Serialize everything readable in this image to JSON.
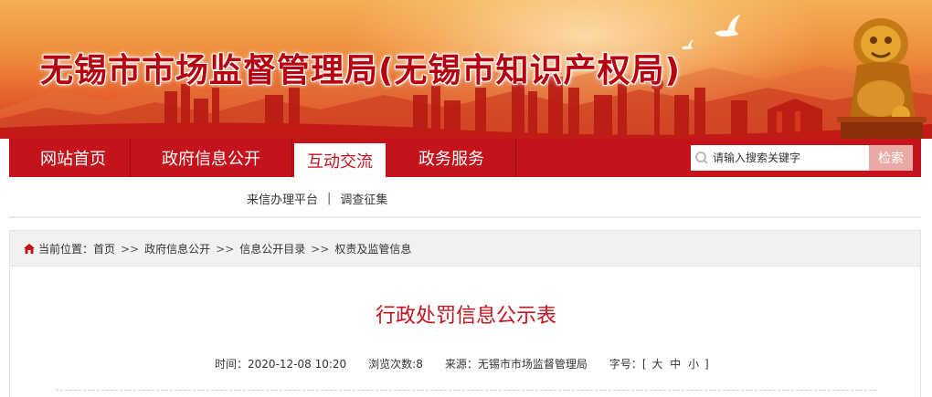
{
  "banner": {
    "title": "无锡市市场监督管理局(无锡市知识产权局)"
  },
  "nav": {
    "items": [
      {
        "label": "网站首页"
      },
      {
        "label": "政府信息公开"
      },
      {
        "label": "互动交流"
      },
      {
        "label": "政务服务"
      }
    ],
    "active_index": 2,
    "search": {
      "placeholder": "请输入搜索关键字",
      "button_label": "检索"
    }
  },
  "subnav": {
    "links": [
      "来信办理平台",
      "调查征集"
    ],
    "separator": "|"
  },
  "breadcrumb": {
    "prefix": "当前位置：",
    "items": [
      "首页",
      "政府信息公开",
      "信息公开目录",
      "权责及监管信息"
    ],
    "arrow": ">>"
  },
  "article": {
    "title": "行政处罚信息公示表",
    "meta": {
      "time_label": "时间：",
      "time_value": "2020-12-08 10:20",
      "views_label": "浏览次数:",
      "views_value": "8",
      "source_label": "来源：",
      "source_value": "无锡市市场监督管理局",
      "fontsize_label": "字号：",
      "fontsize_open": "[",
      "fontsize_options": [
        "大",
        "中",
        "小"
      ],
      "fontsize_close": "]"
    }
  },
  "colors": {
    "primary_red": "#c4131b",
    "banner_title": "#b7000f"
  }
}
